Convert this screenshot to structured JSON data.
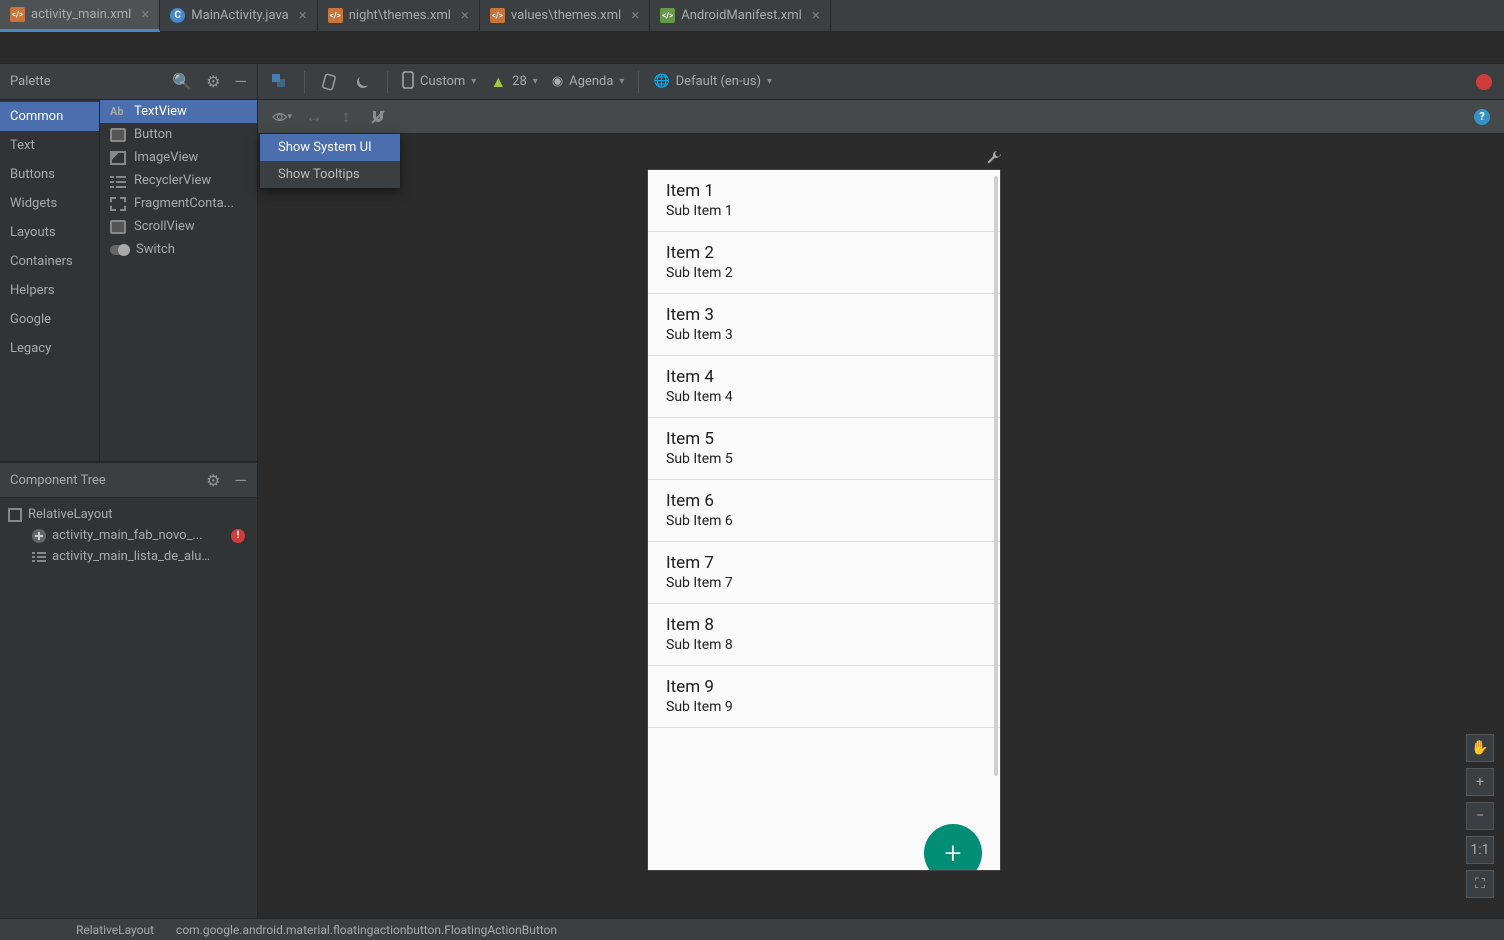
{
  "tabs": [
    {
      "label": "activity_main.xml",
      "icon": "xml",
      "active": true
    },
    {
      "label": "MainActivity.java",
      "icon": "java",
      "active": false
    },
    {
      "label": "night\\themes.xml",
      "icon": "xml",
      "active": false
    },
    {
      "label": "values\\themes.xml",
      "icon": "xml",
      "active": false
    },
    {
      "label": "AndroidManifest.xml",
      "icon": "manifest",
      "active": false
    }
  ],
  "palette": {
    "title": "Palette",
    "categories": [
      "Common",
      "Text",
      "Buttons",
      "Widgets",
      "Layouts",
      "Containers",
      "Helpers",
      "Google",
      "Legacy"
    ],
    "selected_category": "Common",
    "widgets": [
      "TextView",
      "Button",
      "ImageView",
      "RecyclerView",
      "FragmentConta...",
      "ScrollView",
      "Switch"
    ],
    "selected_widget": "TextView"
  },
  "component_tree": {
    "title": "Component Tree",
    "root": "RelativeLayout",
    "children": [
      {
        "label": "activity_main_fab_novo_...",
        "icon": "plus",
        "error": true
      },
      {
        "label": "activity_main_lista_de_alunos",
        "icon": "list",
        "error": false
      }
    ]
  },
  "design_toolbar": {
    "device": "Custom",
    "api": "28",
    "theme": "Agenda",
    "locale": "Default (en-us)"
  },
  "eye_menu": {
    "items": [
      "Show System UI",
      "Show Tooltips"
    ],
    "selected": "Show System UI"
  },
  "preview_list": [
    {
      "title": "Item 1",
      "sub": "Sub Item 1"
    },
    {
      "title": "Item 2",
      "sub": "Sub Item 2"
    },
    {
      "title": "Item 3",
      "sub": "Sub Item 3"
    },
    {
      "title": "Item 4",
      "sub": "Sub Item 4"
    },
    {
      "title": "Item 5",
      "sub": "Sub Item 5"
    },
    {
      "title": "Item 6",
      "sub": "Sub Item 6"
    },
    {
      "title": "Item 7",
      "sub": "Sub Item 7"
    },
    {
      "title": "Item 8",
      "sub": "Sub Item 8"
    },
    {
      "title": "Item 9",
      "sub": "Sub Item 9"
    }
  ],
  "fab_label": "+",
  "zoom_buttons": [
    "✋",
    "+",
    "−",
    "1:1",
    "⛶"
  ],
  "status_bar": [
    "RelativeLayout",
    "com.google.android.material.floatingactionbutton.FloatingActionButton"
  ]
}
